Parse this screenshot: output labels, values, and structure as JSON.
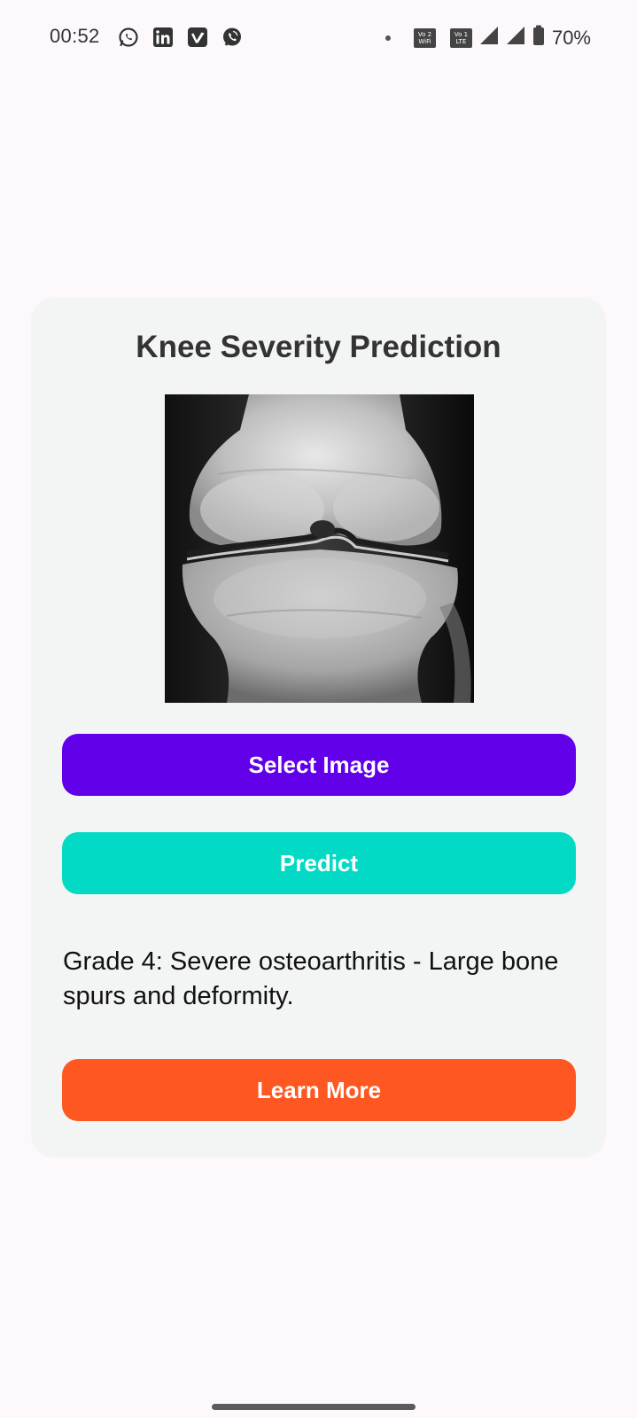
{
  "status_bar": {
    "time": "00:52",
    "left_icons": [
      "whatsapp-icon",
      "linkedin-icon",
      "vimeo-icon",
      "viber-icon"
    ],
    "net_chip_1": {
      "top": "Vo 2",
      "bottom": "WiFi"
    },
    "net_chip_2": {
      "top": "Vo 1",
      "bottom": "LTE"
    },
    "battery": "70%"
  },
  "card": {
    "title": "Knee Severity Prediction",
    "select_button": "Select Image",
    "predict_button": "Predict",
    "result_text": "Grade 4: Severe osteoarthritis - Large bone spurs and deformity.",
    "learn_more_button": "Learn More"
  },
  "colors": {
    "background": "#fdf8fc",
    "card": "#f3f4f4",
    "select": "#6200ea",
    "predict": "#03dac5",
    "learn_more": "#ff5722"
  }
}
